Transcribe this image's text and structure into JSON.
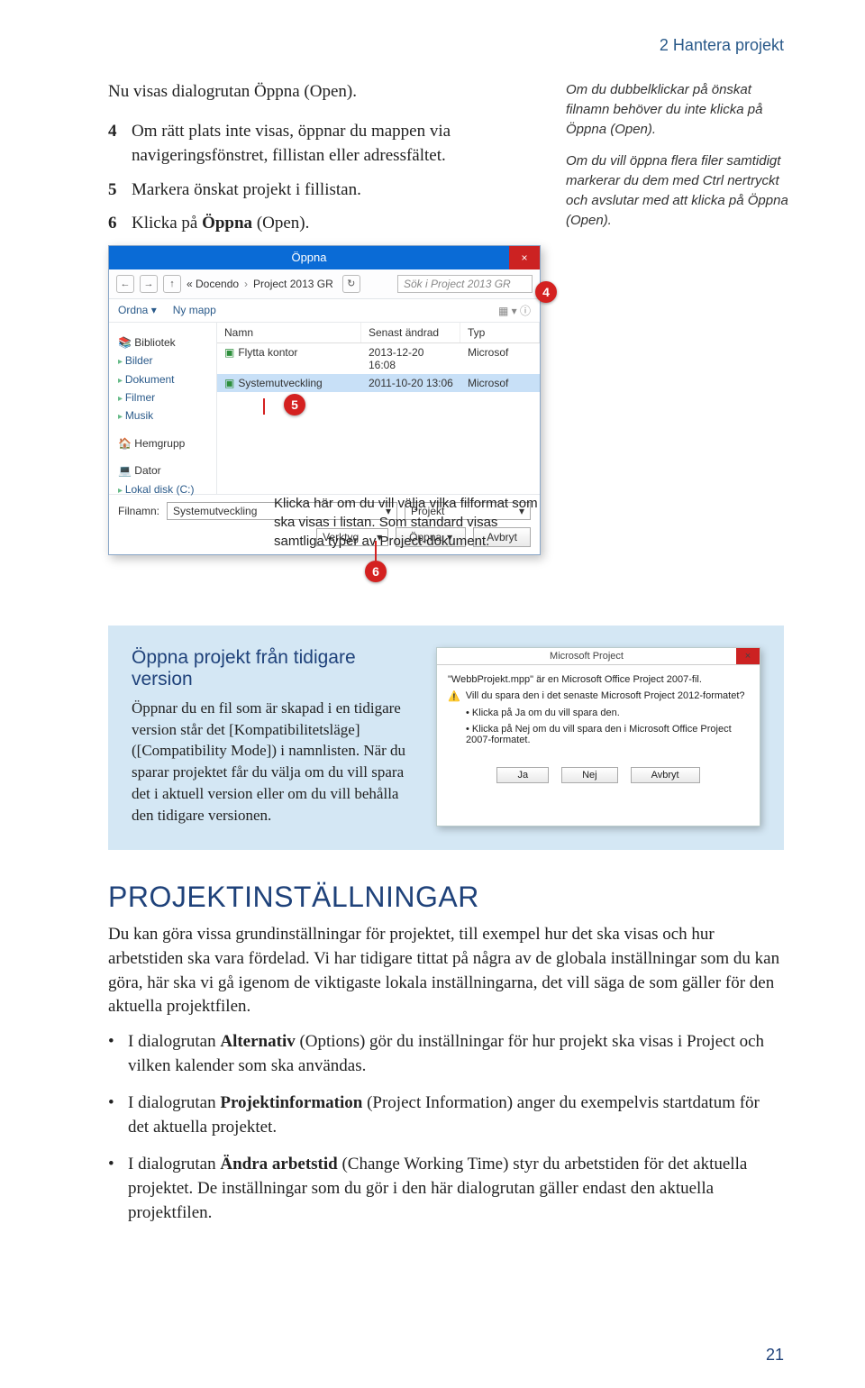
{
  "chapter": "2  Hantera projekt",
  "intro": "Nu visas dialogrutan Öppna (Open).",
  "steps": [
    "Om rätt plats inte visas, öppnar du mappen via navigeringsfönstret, fillistan eller adressfältet.",
    "Markera önskat projekt i fillistan.",
    "Klicka på Öppna (Open)."
  ],
  "step6_bold": "Öppna",
  "sidenote1": "Om du dubbelklickar på önskat filnamn behöver du inte klicka på Öppna (Open).",
  "sidenote2": "Om du vill öppna flera filer samtidigt markerar du dem med Ctrl nertryckt och avslutar med att klicka på Öppna (Open).",
  "dialog": {
    "title": "Öppna",
    "back_icon": "←",
    "fwd_icon": "→",
    "up_icon": "↑",
    "breadcrumb_a": "« Docendo",
    "breadcrumb_b": "Project 2013 GR",
    "refresh_icon": "↻",
    "search_placeholder": "Sök i Project 2013 GR",
    "ordna": "Ordna",
    "nymapp": "Ny mapp",
    "tree": {
      "bibliotek": "Bibliotek",
      "bilder": "Bilder",
      "dokument": "Dokument",
      "filmer": "Filmer",
      "musik": "Musik",
      "hemgrupp": "Hemgrupp",
      "dator": "Dator",
      "lokal": "Lokal disk (C:)"
    },
    "headers": {
      "namn": "Namn",
      "andrad": "Senast ändrad",
      "typ": "Typ"
    },
    "rows": [
      {
        "name": "Flytta kontor",
        "date": "2013-12-20 16:08",
        "type": "Microsof"
      },
      {
        "name": "Systemutveckling",
        "date": "2011-10-20 13:06",
        "type": "Microsof"
      }
    ],
    "filnamn_label": "Filnamn:",
    "filnamn_value": "Systemutveckling",
    "filter": "Projekt",
    "verktyg": "Verktyg",
    "open": "Öppna",
    "cancel": "Avbryt"
  },
  "caption": "Klicka här om du vill välja vilka filformat som ska visas i listan. Som standard visas samtliga typer av Project-dokument.",
  "bluebox": {
    "title": "Öppna projekt från tidigare version",
    "text": "Öppnar du en fil som är skapad i en tidigare version står det [Kompatibilitetsläge] ([Compatibility Mode]) i namnlisten. När du sparar projektet får du välja om du vill spara det i aktuell version eller om du vill behålla den tidigare versionen."
  },
  "ms": {
    "title": "Microsoft Project",
    "l1": "\"WebbProjekt.mpp\" är en Microsoft Office Project 2007-fil.",
    "l2": "Vill du spara den i det senaste Microsoft Project 2012-formatet?",
    "b1": "• Klicka på Ja om du vill spara den.",
    "b2": "• Klicka på Nej om du vill spara den i Microsoft Office Project 2007-formatet.",
    "ja": "Ja",
    "nej": "Nej",
    "avbryt": "Avbryt"
  },
  "section_title": "PROJEKTINSTÄLLNINGAR",
  "section_p": "Du kan göra vissa grundinställningar för projektet, till exempel hur det ska visas och hur arbetstiden ska vara fördelad. Vi har tidigare tittat på några av de globala inställningar som du kan göra, här ska vi gå igenom de viktigaste lokala inställningarna, det vill säga de som gäller för den aktuella projektfilen.",
  "bullets": [
    {
      "bold": "Alternativ",
      "pre": "I dialogrutan ",
      "post": " (Options) gör du inställningar för hur projekt ska visas i Project och vilken kalender som ska användas."
    },
    {
      "bold": "Projektinformation",
      "pre": "I dialogrutan ",
      "post": " (Project Information) anger du exempelvis startdatum för det aktuella projektet."
    },
    {
      "bold": "Ändra arbetstid",
      "pre": "I dialogrutan ",
      "post": " (Change Working Time) styr du arbetstiden för det aktuella projektet. De inställningar som du gör i den här dialogrutan gäller endast den aktuella projektfilen."
    }
  ],
  "pagenum": "21"
}
